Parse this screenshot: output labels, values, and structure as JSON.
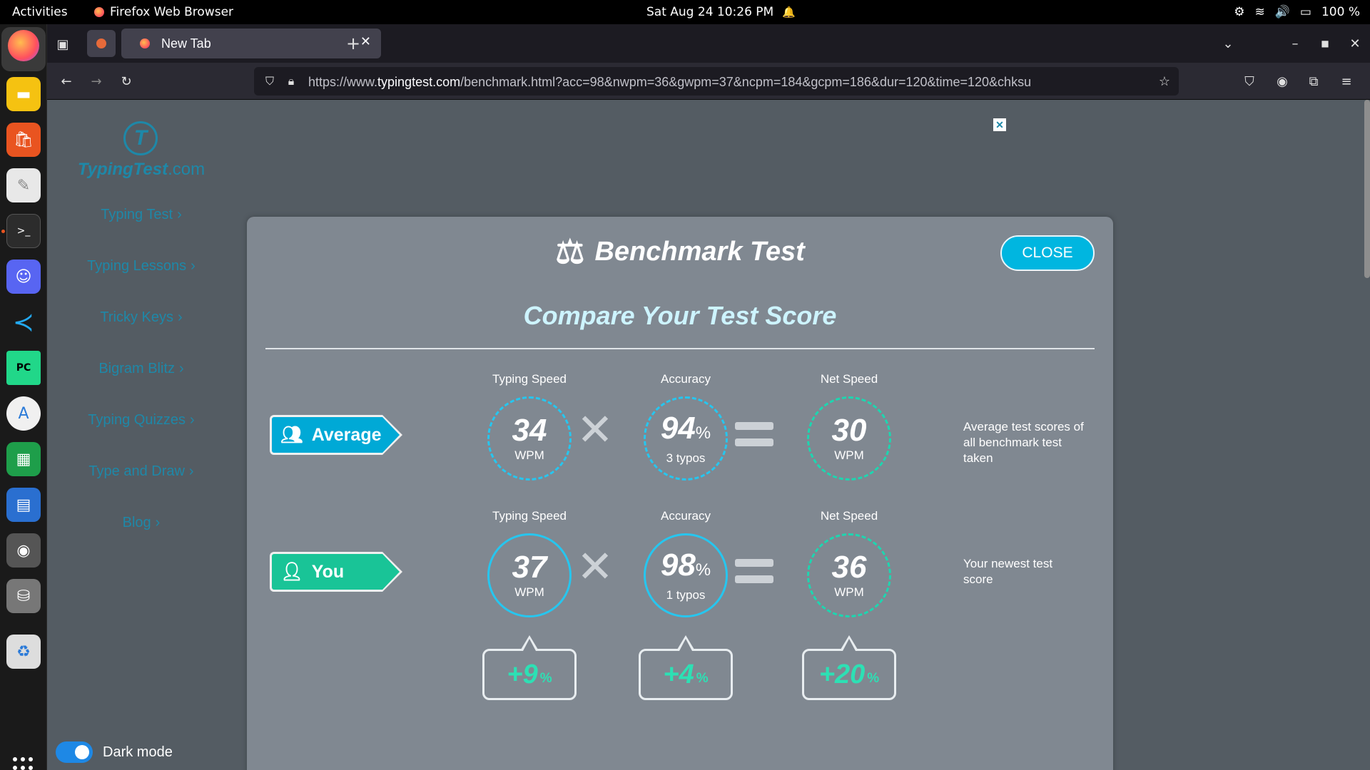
{
  "system": {
    "activities": "Activities",
    "app_name": "Firefox Web Browser",
    "clock": "Sat Aug 24  10:26 PM",
    "battery": "100 %"
  },
  "browser": {
    "tab_title": "New Tab",
    "url_prefix": "https://www.",
    "url_domain": "typingtest.com",
    "url_rest": "/benchmark.html?acc=98&nwpm=36&gwpm=37&ncpm=184&gcpm=186&dur=120&time=120&chksu"
  },
  "site": {
    "logo_main": "TypingTest",
    "logo_suffix": ".com",
    "logo_mark": "T",
    "nav": [
      "Typing Test",
      "Typing Lessons",
      "Tricky Keys",
      "Bigram Blitz",
      "Typing Quizzes",
      "Type and Draw",
      "Blog"
    ],
    "dark_mode_label": "Dark mode"
  },
  "modal": {
    "title": "Benchmark Test",
    "close_label": "CLOSE",
    "subtitle": "Compare Your Test Score",
    "average": {
      "tag": "Average",
      "labels": [
        "Typing Speed",
        "Accuracy",
        "Net Speed"
      ],
      "speed": "34",
      "speed_unit": "WPM",
      "accuracy": "94",
      "accuracy_pct": "%",
      "typos": "3 typos",
      "net": "30",
      "net_unit": "WPM",
      "note": "Average test scores of all benchmark test taken"
    },
    "you": {
      "tag": "You",
      "labels": [
        "Typing Speed",
        "Accuracy",
        "Net Speed"
      ],
      "speed": "37",
      "speed_unit": "WPM",
      "accuracy": "98",
      "accuracy_pct": "%",
      "typos": "1 typos",
      "net": "36",
      "net_unit": "WPM",
      "note": "Your newest test score"
    },
    "diffs": [
      {
        "value": "+9",
        "unit": "%"
      },
      {
        "value": "+4",
        "unit": "%"
      },
      {
        "value": "+20",
        "unit": "%"
      }
    ]
  },
  "colors": {
    "accent": "#00b6e0",
    "average_tag": "#00a9d6",
    "you_tag": "#19c497",
    "diff_text": "#2de0b4"
  }
}
